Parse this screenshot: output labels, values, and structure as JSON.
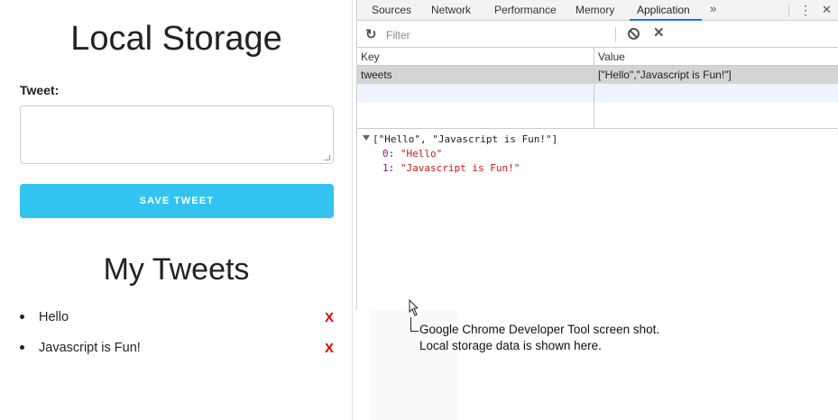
{
  "app": {
    "title": "Local Storage",
    "tweet_label": "Tweet:",
    "tweet_value": "",
    "save_button": "Save Tweet",
    "my_tweets_title": "My Tweets",
    "tweets": [
      {
        "text": "Hello",
        "remove": "X"
      },
      {
        "text": "Javascript is Fun!",
        "remove": "X"
      }
    ]
  },
  "devtools": {
    "tabs": [
      "Sources",
      "Network",
      "Performance",
      "Memory",
      "Application"
    ],
    "active_tab": "Application",
    "more_tabs": "»",
    "kebab": "⋮",
    "close": "✕",
    "filter_placeholder": "Filter",
    "table": {
      "columns": [
        "Key",
        "Value"
      ],
      "rows": [
        {
          "key": "tweets",
          "value": "[\"Hello\",\"Javascript is Fun!\"]"
        }
      ]
    },
    "preview": {
      "summary": "[\"Hello\", \"Javascript is Fun!\"]",
      "items": [
        {
          "index": "0",
          "value": "\"Hello\""
        },
        {
          "index": "1",
          "value": "\"Javascript is Fun!\""
        }
      ]
    }
  },
  "annotation": {
    "line1": "Google Chrome Developer Tool screen shot.",
    "line2": "Local storage data is shown here."
  },
  "colors": {
    "save_button": "#33c3f0",
    "remove_x": "#e00000",
    "active_tab_underline": "#1a73e8",
    "selected_row": "#d4d4d4",
    "preview_index": "#881391",
    "preview_string": "#c41a16"
  },
  "icons": {
    "refresh": "refresh-icon",
    "clear_all": "clear-all-icon",
    "delete": "delete-icon",
    "expand": "expand-triangle-icon",
    "cursor": "mouse-cursor-icon"
  }
}
